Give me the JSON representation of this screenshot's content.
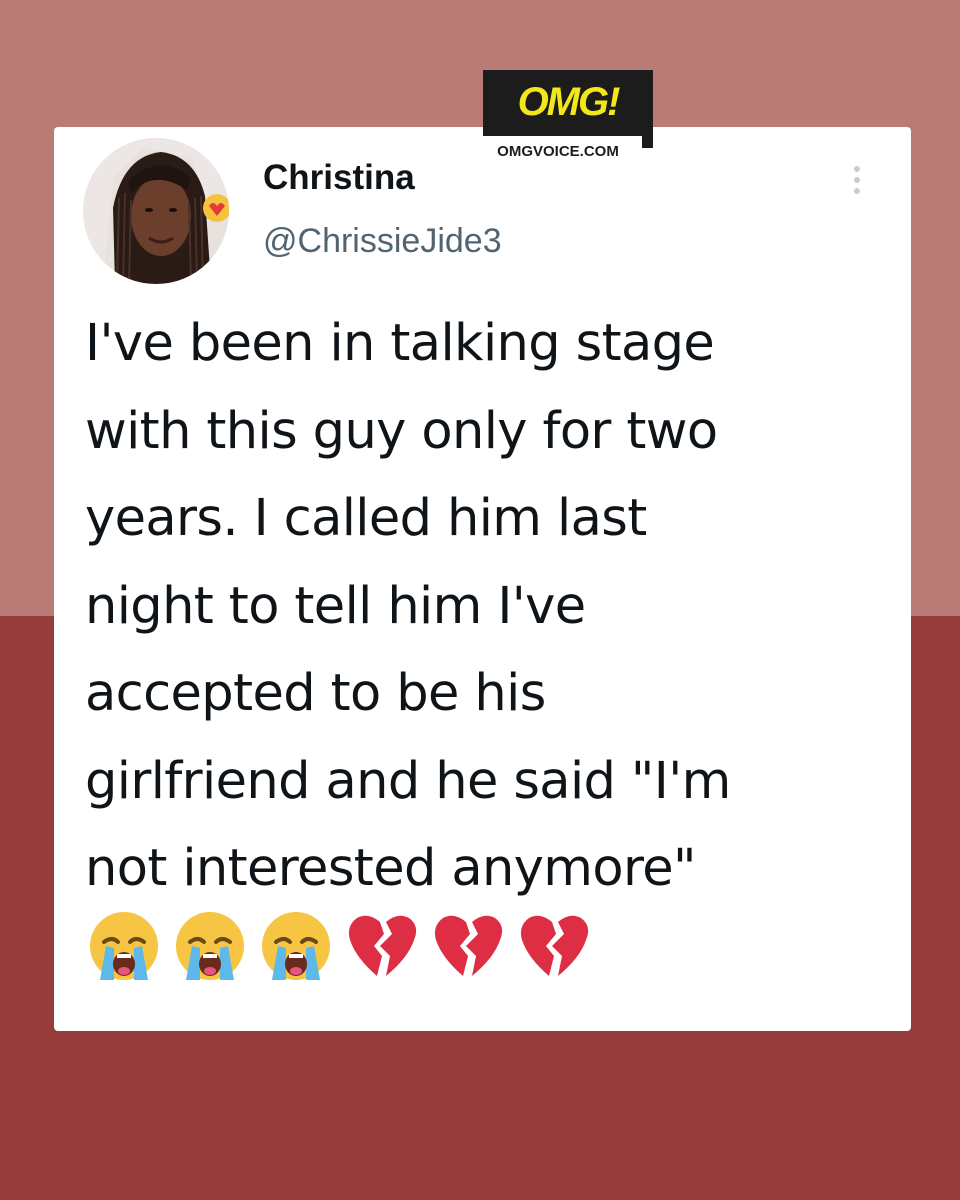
{
  "brand": {
    "logo_text": "OMG!",
    "site_url": "OMGVOICE.COM",
    "logo_bg_color": "#1c1c1c",
    "logo_text_color": "#f3e61a"
  },
  "background": {
    "top_color": "#b97b76",
    "bottom_color": "#963c3b"
  },
  "tweet": {
    "author": {
      "display_name": "Christina",
      "handle": "@ChrissieJide3"
    },
    "more_icon": "more-vertical-icon",
    "text_lines": [
      "I've been in talking stage",
      "with this guy only for two",
      "years. I called him last",
      "night to tell him I've",
      "accepted to be his",
      "girlfriend and he said \"I'm",
      "not interested anymore\""
    ],
    "emojis": [
      "loudly-crying-face-icon",
      "loudly-crying-face-icon",
      "loudly-crying-face-icon",
      "broken-heart-icon",
      "broken-heart-icon",
      "broken-heart-icon"
    ]
  }
}
